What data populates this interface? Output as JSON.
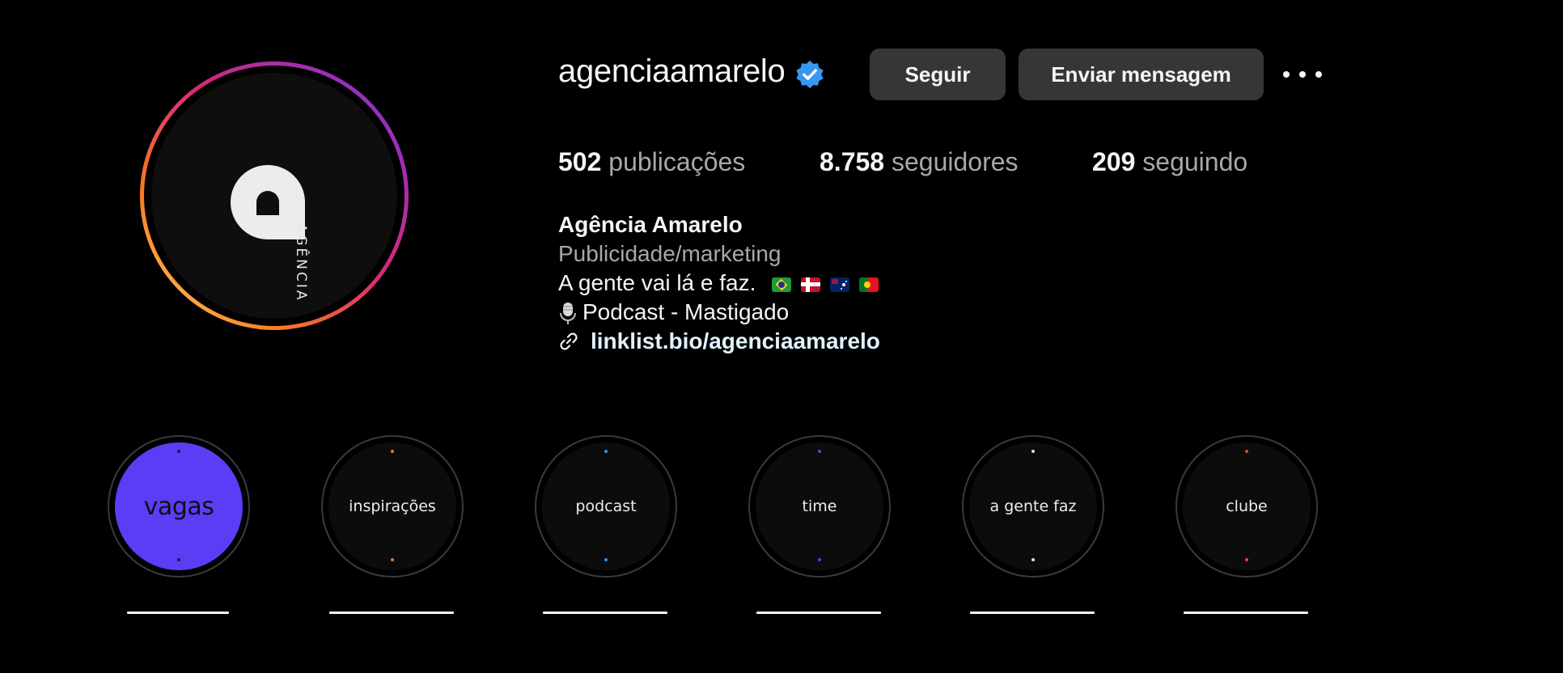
{
  "profile": {
    "username": "agenciaamarelo",
    "verified_icon": "verified-badge-icon",
    "avatar_logo_text": "AGÊNCIA"
  },
  "actions": {
    "follow_label": "Seguir",
    "message_label": "Enviar mensagem",
    "more_icon": "more-options-icon"
  },
  "stats": {
    "posts_count": "502",
    "posts_label": "publicações",
    "followers_count": "8.758",
    "followers_label": "seguidores",
    "following_count": "209",
    "following_label": "seguindo"
  },
  "bio": {
    "name": "Agência Amarelo",
    "category": "Publicidade/marketing",
    "line1": "A gente vai lá e faz.",
    "line1_flags": [
      "flag-brazil",
      "flag-norway",
      "flag-australia",
      "flag-portugal"
    ],
    "line2": "Podcast - Mastigado",
    "line2_icon": "microphone-icon",
    "link_icon": "link-icon",
    "link": "linklist.bio/agenciaamarelo"
  },
  "highlights": [
    {
      "label": "vagas",
      "active": true,
      "dot_color": "#1a1a4a"
    },
    {
      "label": "inspirações",
      "active": false,
      "dot_color": "#e8762b"
    },
    {
      "label": "podcast",
      "active": false,
      "dot_color": "#2f8ff0"
    },
    {
      "label": "time",
      "active": false,
      "dot_color": "#5a3cf0"
    },
    {
      "label": "a gente faz",
      "active": false,
      "dot_color": "#dcdcdc"
    },
    {
      "label": "clube",
      "active": false,
      "dot_color": "#e8452b"
    }
  ],
  "colors": {
    "background": "#000000",
    "button_bg": "#363636",
    "verified_blue": "#3897f0",
    "highlight_active": "#5c3cf5",
    "link_text": "#e0f1ff"
  }
}
